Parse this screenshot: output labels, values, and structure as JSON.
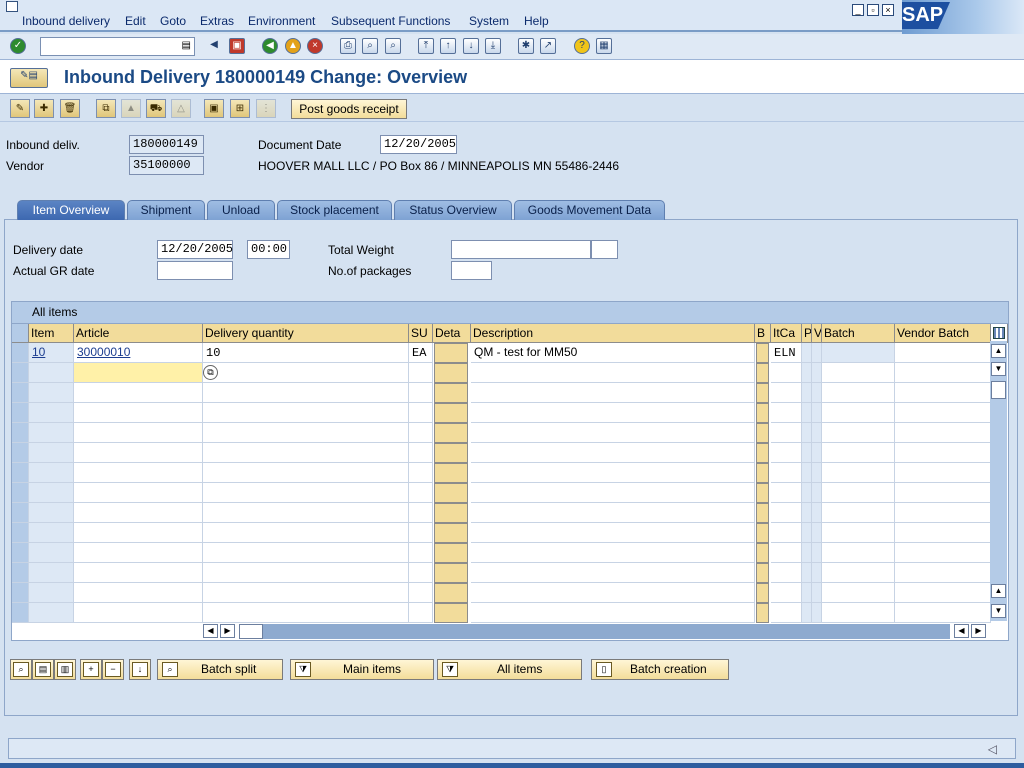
{
  "menu": [
    "Inbound delivery",
    "Edit",
    "Goto",
    "Extras",
    "Environment",
    "Subsequent Functions",
    "System",
    "Help"
  ],
  "brand": "SAP",
  "title": "Inbound Delivery 180000149 Change: Overview",
  "app_toolbar": {
    "post_goods_receipt": "Post goods receipt"
  },
  "header": {
    "inbound_deliv_label": "Inbound deliv.",
    "inbound_deliv_value": "180000149",
    "vendor_label": "Vendor",
    "vendor_value": "35100000",
    "document_date_label": "Document Date",
    "document_date_value": "12/20/2005",
    "vendor_address": "HOOVER MALL LLC / PO Box 86 / MINNEAPOLIS MN 55486-2446"
  },
  "tabs": [
    "Item Overview",
    "Shipment",
    "Unload",
    "Stock placement",
    "Status Overview",
    "Goods Movement Data"
  ],
  "overview": {
    "delivery_date_label": "Delivery date",
    "delivery_date_value": "12/20/2005",
    "delivery_time_value": "00:00",
    "actual_gr_date_label": "Actual GR date",
    "total_weight_label": "Total Weight",
    "packages_label": "No.of packages"
  },
  "grid": {
    "title": "All items",
    "columns": [
      "Item",
      "Article",
      "Delivery quantity",
      "SU",
      "Deta",
      "Description",
      "B",
      "ItCa",
      "P",
      "V",
      "Batch",
      "Vendor Batch"
    ],
    "rows": [
      {
        "item": "10",
        "article": "30000010",
        "qty": "10",
        "su": "EA",
        "description": "QM - test for MM50",
        "itca": "ELN"
      }
    ]
  },
  "bottom_buttons": {
    "batch_split": "Batch split",
    "main_items": "Main items",
    "all_items": "All items",
    "batch_creation": "Batch creation"
  }
}
